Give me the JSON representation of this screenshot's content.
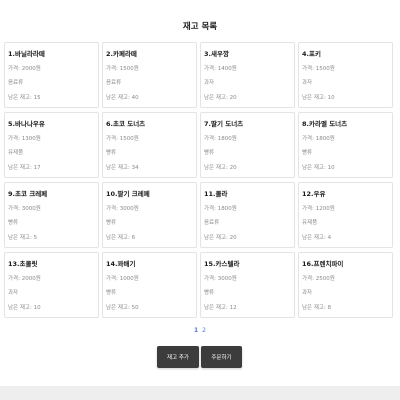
{
  "header": {
    "title": "재고 목록"
  },
  "items": [
    {
      "title": "1.바닐라라떼",
      "price": "가격: 2000원",
      "category": "음료류",
      "stock": "남은 재고: 15"
    },
    {
      "title": "2.카페라떼",
      "price": "가격: 1500원",
      "category": "음료류",
      "stock": "남은 재고: 40"
    },
    {
      "title": "3.새우깡",
      "price": "가격: 1400원",
      "category": "과자",
      "stock": "남은 재고: 20"
    },
    {
      "title": "4.포키",
      "price": "가격: 1500원",
      "category": "과자",
      "stock": "남은 재고: 10"
    },
    {
      "title": "5.바나나우유",
      "price": "가격: 1300원",
      "category": "유제품",
      "stock": "남은 재고: 17"
    },
    {
      "title": "6.초코 도너츠",
      "price": "가격: 1500원",
      "category": "빵류",
      "stock": "남은 재고: 34"
    },
    {
      "title": "7.딸기 도너츠",
      "price": "가격: 1800원",
      "category": "빵류",
      "stock": "남은 재고: 20"
    },
    {
      "title": "8.카라멜 도너츠",
      "price": "가격: 1800원",
      "category": "빵류",
      "stock": "남은 재고: 10"
    },
    {
      "title": "9.초코 크레페",
      "price": "가격: 3000원",
      "category": "빵류",
      "stock": "남은 재고: 5"
    },
    {
      "title": "10.딸기 크레페",
      "price": "가격: 3000원",
      "category": "빵류",
      "stock": "남은 재고: 6"
    },
    {
      "title": "11.콜라",
      "price": "가격: 1800원",
      "category": "음료류",
      "stock": "남은 재고: 20"
    },
    {
      "title": "12.우유",
      "price": "가격: 1200원",
      "category": "유제품",
      "stock": "남은 재고: 4"
    },
    {
      "title": "13.초콜릿",
      "price": "가격: 2000원",
      "category": "과자",
      "stock": "남은 재고: 10"
    },
    {
      "title": "14.꽈배기",
      "price": "가격: 1000원",
      "category": "빵류",
      "stock": "남은 재고: 50"
    },
    {
      "title": "15.카스텔라",
      "price": "가격: 3000원",
      "category": "빵류",
      "stock": "남은 재고: 12"
    },
    {
      "title": "16.프렌치파이",
      "price": "가격: 2500원",
      "category": "과자",
      "stock": "남은 재고: 8"
    }
  ],
  "pagination": {
    "pages": [
      "1",
      "2"
    ],
    "current_page": 1
  },
  "actions": {
    "add_label": "재고 추가",
    "order_label": "주문하기"
  },
  "colors": {
    "accent": "#4a78d0",
    "button_bg": "#3c3c3c",
    "card_border": "#e4e4e4"
  }
}
